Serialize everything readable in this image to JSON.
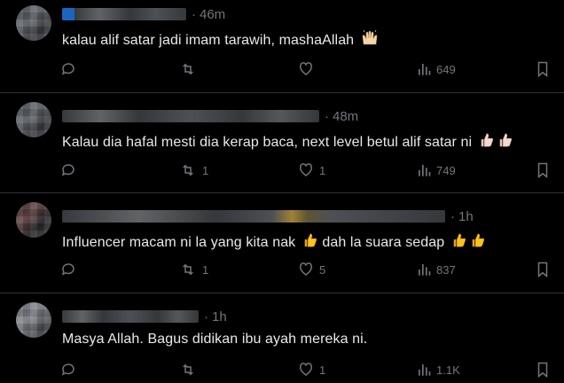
{
  "posts": [
    {
      "time": "46m",
      "text": "kalau alif satar jadi imam tarawih, mashaAllah",
      "emoji": [
        "raising-hands"
      ],
      "replies": "",
      "reposts": "",
      "likes": "",
      "views": "649"
    },
    {
      "time": "48m",
      "text": "Kalau dia hafal mesti dia kerap baca, next level betul alif satar ni",
      "emoji": [
        "thumbs-up-light",
        "thumbs-up-light"
      ],
      "replies": "",
      "reposts": "1",
      "likes": "1",
      "views": "749"
    },
    {
      "time": "1h",
      "text": "Influencer macam ni la yang kita nak",
      "text2": "dah la suara sedap",
      "emoji": [
        "thumbs-up-yellow"
      ],
      "emoji2": [
        "thumbs-up-yellow",
        "thumbs-up-yellow"
      ],
      "replies": "",
      "reposts": "1",
      "likes": "5",
      "views": "837"
    },
    {
      "time": "1h",
      "text": "Masya Allah. Bagus didikan ibu ayah mereka ni.",
      "emoji": [],
      "replies": "",
      "reposts": "",
      "likes": "1",
      "views": "1.1K"
    }
  ],
  "separator": "·",
  "colors": {
    "background": "#000000",
    "text": "#e7e9ea",
    "muted": "#71767b",
    "border": "#2f3336",
    "verified": "#1d9bf0"
  },
  "icons": [
    "reply-icon",
    "repost-icon",
    "like-icon",
    "views-icon",
    "bookmark-icon"
  ]
}
